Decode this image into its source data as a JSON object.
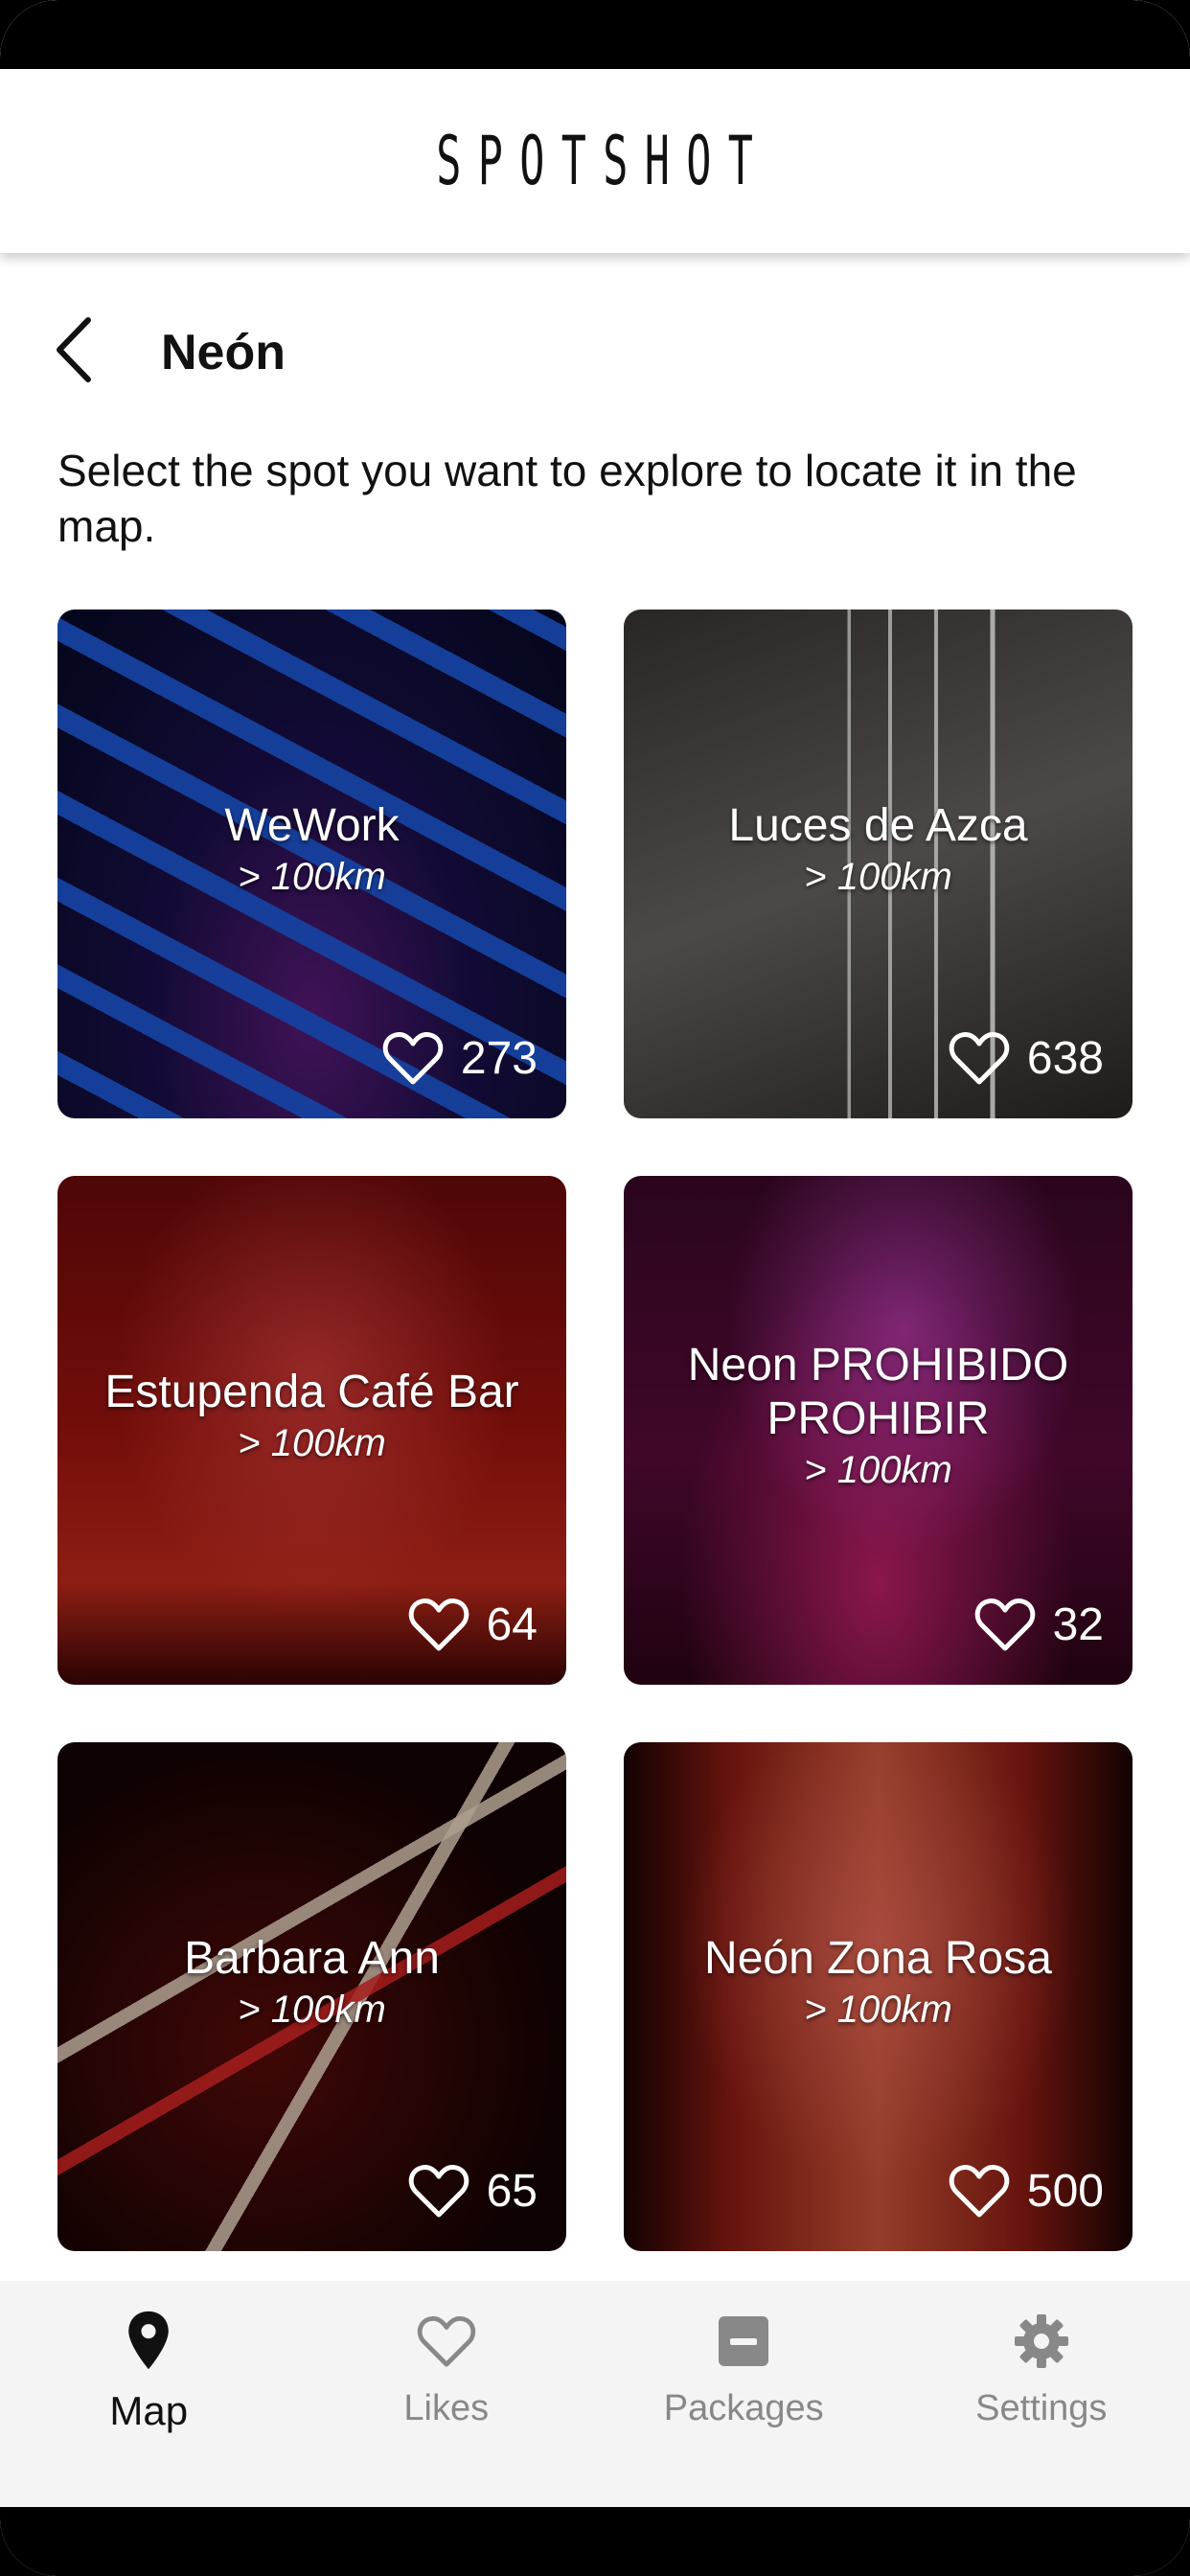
{
  "app": {
    "logo": "SPOTSHOT"
  },
  "page": {
    "title": "Neón",
    "instructions": "Select the spot you want to explore to locate it in the map."
  },
  "spots": [
    {
      "name": "WeWork",
      "distance": "> 100km",
      "likes": "273"
    },
    {
      "name": "Luces de Azca",
      "distance": "> 100km",
      "likes": "638"
    },
    {
      "name": "Estupenda Café Bar",
      "distance": "> 100km",
      "likes": "64"
    },
    {
      "name": "Neon PROHIBIDO PROHIBIR",
      "distance": "> 100km",
      "likes": "32"
    },
    {
      "name": "Barbara Ann",
      "distance": "> 100km",
      "likes": "65"
    },
    {
      "name": "Neón Zona Rosa",
      "distance": "> 100km",
      "likes": "500"
    }
  ],
  "tabbar": {
    "active": "map",
    "items": [
      {
        "id": "map",
        "label": "Map",
        "icon": "map-pin-icon"
      },
      {
        "id": "likes",
        "label": "Likes",
        "icon": "heart-icon"
      },
      {
        "id": "packages",
        "label": "Packages",
        "icon": "package-icon"
      },
      {
        "id": "settings",
        "label": "Settings",
        "icon": "gear-icon"
      }
    ]
  },
  "colors": {
    "active_tab": "#111111",
    "inactive_tab": "#888888",
    "tabbar_bg": "#f4f4f4"
  }
}
